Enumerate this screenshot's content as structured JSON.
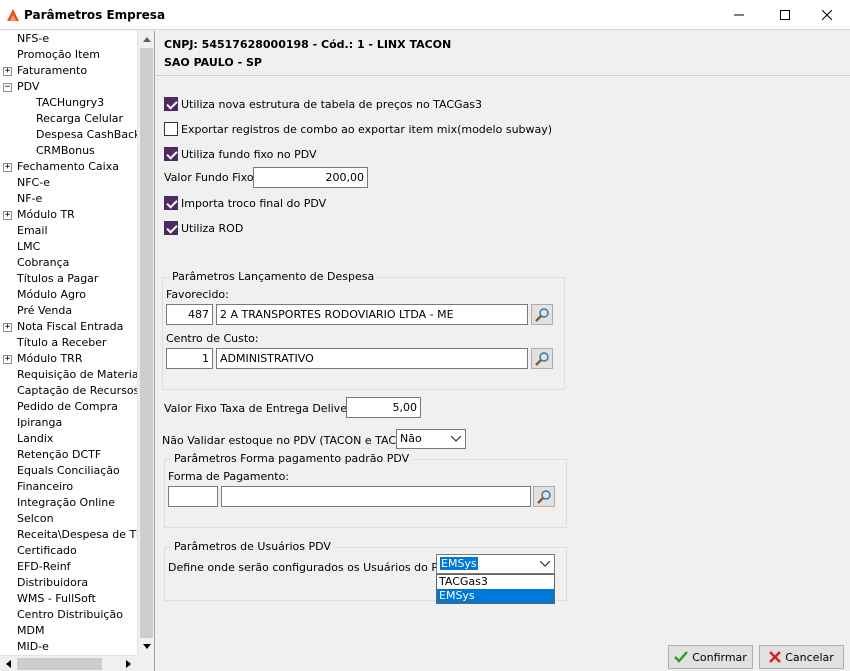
{
  "window": {
    "title": "Parâmetros Empresa"
  },
  "tree": {
    "items": [
      {
        "label": "NFS-e",
        "indent": 0,
        "expander": ""
      },
      {
        "label": "Promoção Item",
        "indent": 0,
        "expander": ""
      },
      {
        "label": "Faturamento",
        "indent": 0,
        "expander": "+"
      },
      {
        "label": "PDV",
        "indent": 0,
        "expander": "-"
      },
      {
        "label": "TACHungry3",
        "indent": 2,
        "expander": ""
      },
      {
        "label": "Recarga Celular",
        "indent": 2,
        "expander": ""
      },
      {
        "label": "Despesa CashBack",
        "indent": 2,
        "expander": ""
      },
      {
        "label": "CRMBonus",
        "indent": 2,
        "expander": ""
      },
      {
        "label": "Fechamento Caixa",
        "indent": 0,
        "expander": "+"
      },
      {
        "label": "NFC-e",
        "indent": 0,
        "expander": ""
      },
      {
        "label": "NF-e",
        "indent": 0,
        "expander": ""
      },
      {
        "label": "Módulo TR",
        "indent": 0,
        "expander": "+"
      },
      {
        "label": "Email",
        "indent": 0,
        "expander": ""
      },
      {
        "label": "LMC",
        "indent": 0,
        "expander": ""
      },
      {
        "label": "Cobrança",
        "indent": 0,
        "expander": ""
      },
      {
        "label": "Títulos a Pagar",
        "indent": 0,
        "expander": ""
      },
      {
        "label": "Módulo Agro",
        "indent": 0,
        "expander": ""
      },
      {
        "label": "Pré Venda",
        "indent": 0,
        "expander": ""
      },
      {
        "label": "Nota Fiscal Entrada",
        "indent": 0,
        "expander": "+"
      },
      {
        "label": "Título a Receber",
        "indent": 0,
        "expander": ""
      },
      {
        "label": "Módulo TRR",
        "indent": 0,
        "expander": "+"
      },
      {
        "label": "Requisição de Materiais",
        "indent": 0,
        "expander": ""
      },
      {
        "label": "Captação de Recursos",
        "indent": 0,
        "expander": ""
      },
      {
        "label": "Pedido de Compra",
        "indent": 0,
        "expander": ""
      },
      {
        "label": "Ipiranga",
        "indent": 0,
        "expander": ""
      },
      {
        "label": "Landix",
        "indent": 0,
        "expander": ""
      },
      {
        "label": "Retenção DCTF",
        "indent": 0,
        "expander": ""
      },
      {
        "label": "Equals Conciliação",
        "indent": 0,
        "expander": ""
      },
      {
        "label": "Financeiro",
        "indent": 0,
        "expander": ""
      },
      {
        "label": "Integração Online",
        "indent": 0,
        "expander": ""
      },
      {
        "label": "Selcon",
        "indent": 0,
        "expander": ""
      },
      {
        "label": "Receita\\Despesa de Titul",
        "indent": 0,
        "expander": ""
      },
      {
        "label": "Certificado",
        "indent": 0,
        "expander": ""
      },
      {
        "label": "EFD-Reinf",
        "indent": 0,
        "expander": ""
      },
      {
        "label": "Distribuidora",
        "indent": 0,
        "expander": ""
      },
      {
        "label": "WMS - FullSoft",
        "indent": 0,
        "expander": ""
      },
      {
        "label": "Centro Distribuição",
        "indent": 0,
        "expander": ""
      },
      {
        "label": "MDM",
        "indent": 0,
        "expander": ""
      },
      {
        "label": "MID-e",
        "indent": 0,
        "expander": ""
      }
    ]
  },
  "header": {
    "line1": "CNPJ: 54517628000198 - Cód.: 1 - LINX TACON",
    "line2": "SAO PAULO - SP"
  },
  "options": {
    "nova_estrutura": {
      "label": "Utiliza nova estrutura de tabela de preços no TACGas3",
      "checked": true
    },
    "exportar_combo": {
      "label": "Exportar registros de combo ao exportar item mix(modelo subway)",
      "checked": false
    },
    "fundo_fixo": {
      "label": "Utiliza fundo fixo no PDV",
      "checked": true
    },
    "valor_fundo_fixo": {
      "label": "Valor Fundo Fixo:",
      "value": "200,00"
    },
    "importa_troco": {
      "label": "Importa troco final do PDV",
      "checked": true
    },
    "utiliza_rod": {
      "label": "Utiliza ROD",
      "checked": true
    }
  },
  "despesa": {
    "title": "Parâmetros Lançamento de Despesa",
    "favorecido_label": "Favorecido:",
    "favorecido_code": "487",
    "favorecido_name": "2 A TRANSPORTES RODOVIARIO LTDA - ME",
    "centro_label": "Centro de Custo:",
    "centro_code": "1",
    "centro_name": "ADMINISTRATIVO"
  },
  "delivery": {
    "label": "Valor Fixo Taxa de Entrega Delivery:",
    "value": "5,00"
  },
  "estoque": {
    "label": "Não Validar estoque no PDV (TACON e TAC off):",
    "value": "Não"
  },
  "pagamento": {
    "title": "Parâmetros Forma pagamento padrão PDV",
    "forma_label": "Forma de Pagamento:",
    "code": "",
    "name": ""
  },
  "usuarios": {
    "title": "Parâmetros de Usuários PDV",
    "label": "Define onde serão configurados os Usuários do PDV:",
    "selected": "EMSys",
    "options": [
      "TACGas3",
      "EMSys"
    ]
  },
  "buttons": {
    "confirm": "Confirmar",
    "cancel": "Cancelar"
  },
  "colors": {
    "checkbox_checked": "#4e2a62",
    "selection": "#0078d7"
  }
}
